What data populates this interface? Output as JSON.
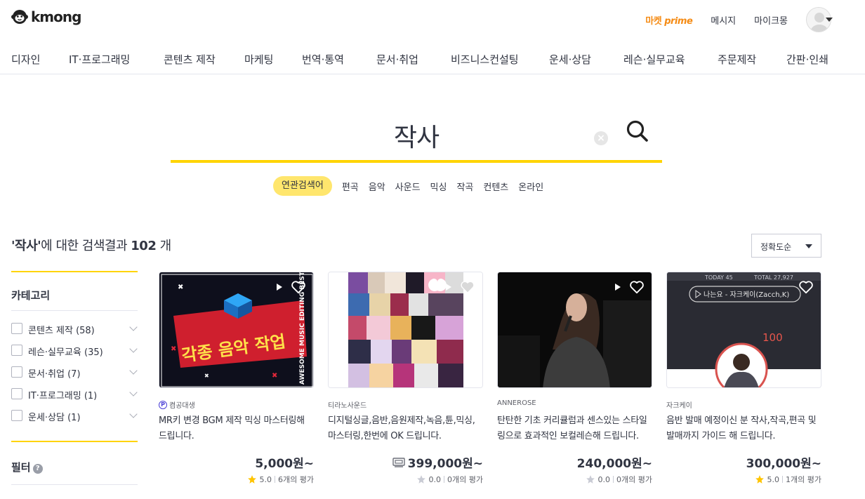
{
  "header": {
    "logo_text": "kmong",
    "prime_prefix": "마켓",
    "prime_suffix": "prime",
    "messages": "메시지",
    "mykmong": "마이크몽"
  },
  "categories": [
    "디자인",
    "IT·프로그래밍",
    "콘텐츠 제작",
    "마케팅",
    "번역·통역",
    "문서·취업",
    "비즈니스컨설팅",
    "운세·상담",
    "레슨·실무교육",
    "주문제작",
    "간판·인쇄"
  ],
  "search": {
    "value": "작사",
    "clear": "×"
  },
  "related": {
    "label": "연관검색어",
    "items": [
      "편곡",
      "음악",
      "사운드",
      "믹싱",
      "작곡",
      "컨텐츠",
      "온라인"
    ]
  },
  "results": {
    "keyword": "'작사'",
    "middle": "에 대한 검색결과",
    "count": "102",
    "unit": "개"
  },
  "sort": {
    "label": "정확도순"
  },
  "sidebar": {
    "category_title": "카테고리",
    "items": [
      {
        "label": "콘텐츠 제작 (58)"
      },
      {
        "label": "레슨·실무교육 (35)"
      },
      {
        "label": "문서·취업 (7)"
      },
      {
        "label": "IT·프로그래밍 (1)"
      },
      {
        "label": "운세·상담 (1)"
      }
    ],
    "filter_title": "필터",
    "help": "?"
  },
  "cards": [
    {
      "seller": "켬공대생",
      "seller_badge": "P",
      "title": "MR키 변경 BGM 제작 믹싱 마스터링해 드립니다.",
      "thumb_text": "각종 음악 작업",
      "thumb_sub": "AWESOME MUSIC EDITING BEST",
      "price": "5,000원~",
      "score": "5.0",
      "reviews": "6개의 평가",
      "star_color": "#ffc400"
    },
    {
      "seller": "티라노사운드",
      "title": "디지털싱글,음반,음원제작,녹음,튠,믹싱,마스터링,한번에 OK 드립니다.",
      "price": "399,000원~",
      "score": "0.0",
      "reviews": "0개의 평가",
      "star_color": "#c9cbd4"
    },
    {
      "seller": "ANNEROSE",
      "title": "탄탄한 기초 커리큘럼과 센스있는 스타일링으로 효과적인 보컬레슨해 드립니다.",
      "price": "240,000원~",
      "score": "0.0",
      "reviews": "0개의 평가",
      "star_color": "#c9cbd4"
    },
    {
      "seller": "자크케이",
      "title": "음반 발매 예정이신 분 작사,작곡,편곡 및 발매까지 가이드 해 드립니다.",
      "thumb_today": "TODAY 45",
      "thumb_total": "TOTAL 27,927",
      "thumb_song": "나는요 - 자크케이(Zacch,K)",
      "thumb_pct": "100",
      "price": "300,000원~",
      "score": "5.0",
      "reviews": "1개의 평가",
      "star_color": "#ffc400"
    }
  ]
}
